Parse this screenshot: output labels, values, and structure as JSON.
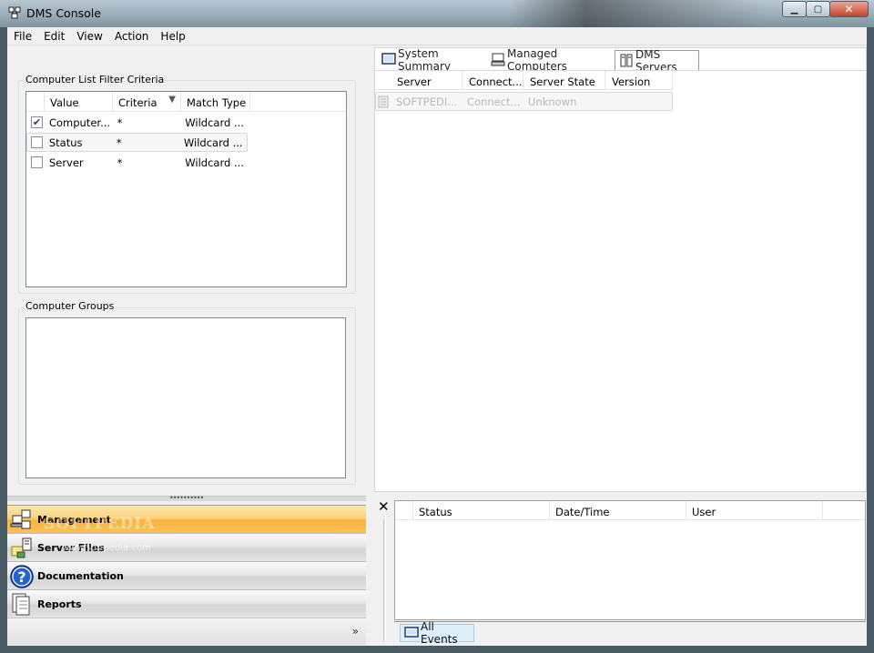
{
  "window": {
    "title": "DMS Console",
    "watermark": "SOFTPEDIA"
  },
  "menu": [
    "File",
    "Edit",
    "View",
    "Action",
    "Help"
  ],
  "filter": {
    "label": "Computer List Filter Criteria",
    "columns": [
      "Value",
      "Criteria",
      "Match Type"
    ],
    "rows": [
      {
        "checked": true,
        "value": "Computer...",
        "criteria": "*",
        "match": "Wildcard ..."
      },
      {
        "checked": false,
        "value": "Status",
        "criteria": "*",
        "match": "Wildcard ..."
      },
      {
        "checked": false,
        "value": "Server",
        "criteria": "*",
        "match": "Wildcard ..."
      }
    ]
  },
  "groups": {
    "label": "Computer Groups"
  },
  "nav": {
    "items": [
      {
        "label": "Management",
        "active": true
      },
      {
        "label": "Server Files",
        "active": false
      },
      {
        "label": "Documentation",
        "active": false
      },
      {
        "label": "Reports",
        "active": false
      }
    ],
    "watermark": "SOFTPEDIA",
    "watermark_sub": "www.softpedia.com",
    "expand": "»"
  },
  "tabs": [
    {
      "label": "System Summary",
      "active": false
    },
    {
      "label": "Managed Computers",
      "active": false
    },
    {
      "label": "DMS Servers",
      "active": true
    }
  ],
  "servers": {
    "columns": [
      "Server",
      "Connect...",
      "Server State",
      "Version"
    ],
    "rows": [
      {
        "server": "SOFTPEDI...",
        "connect": "Connect...",
        "state": "Unknown",
        "version": ""
      }
    ]
  },
  "events": {
    "close": "✕",
    "columns": [
      "Status",
      "Date/Time",
      "User"
    ],
    "tab": "All Events"
  }
}
